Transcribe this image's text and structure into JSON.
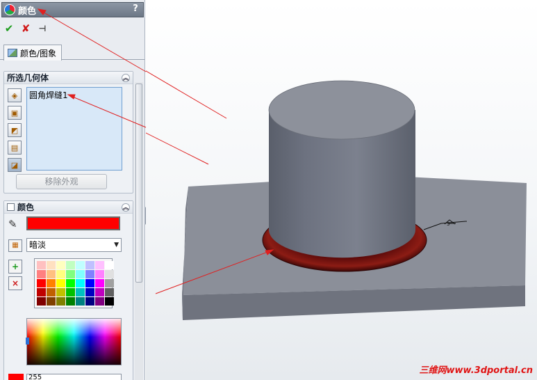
{
  "panel": {
    "title": "颜色",
    "help": "?",
    "actions": {
      "ok": "✔",
      "cancel": "✘",
      "pin": "⊣"
    },
    "tab": {
      "label": "颜色/图象"
    },
    "geometry_group": {
      "header": "所选几何体",
      "items": [
        "圆角焊缝1"
      ],
      "remove_button": "移除外观"
    },
    "color_group": {
      "header": "颜色",
      "current_color": "#ff0000",
      "mode": "暗淡",
      "red_value": "255"
    }
  },
  "palette": [
    "#ffc0c0",
    "#ffe0c0",
    "#ffffc0",
    "#c0ffc0",
    "#c0ffff",
    "#c0c0ff",
    "#ffc0ff",
    "#ffffff",
    "#ff8080",
    "#ffc080",
    "#ffff80",
    "#80ff80",
    "#80ffff",
    "#8080ff",
    "#ff80ff",
    "#e0e0e0",
    "#ff0000",
    "#ff8000",
    "#ffff00",
    "#00ff00",
    "#00ffff",
    "#0000ff",
    "#ff00ff",
    "#a0a0a0",
    "#c00000",
    "#c06000",
    "#c0c000",
    "#00c000",
    "#00c0c0",
    "#0000c0",
    "#c000c0",
    "#606060",
    "#800000",
    "#804000",
    "#808000",
    "#008000",
    "#008080",
    "#000080",
    "#800080",
    "#000000"
  ],
  "watermark": "三维网www.3dportal.cn",
  "colors": {
    "accent_red": "#ff0000",
    "arrow_red": "#e02020"
  }
}
